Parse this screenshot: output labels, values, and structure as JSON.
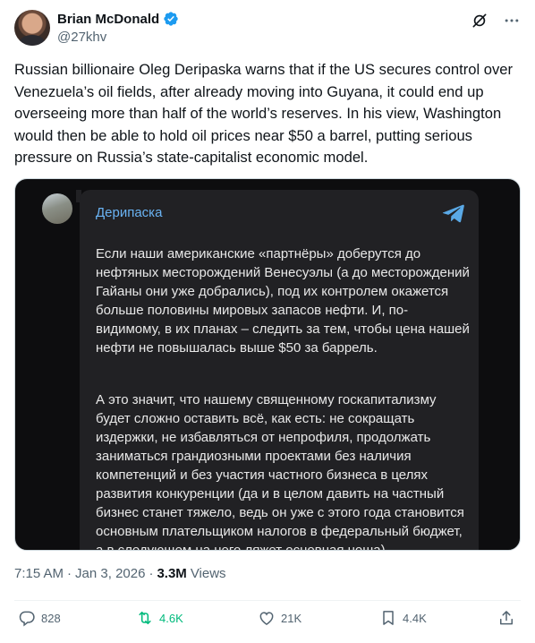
{
  "author": {
    "name": "Brian McDonald",
    "handle": "@27khv",
    "verified": true
  },
  "icons": [
    "verified-badge-icon",
    "grok-icon",
    "more-icon",
    "telegram-icon",
    "reply-icon",
    "retweet-icon",
    "like-icon",
    "bookmark-icon",
    "share-icon"
  ],
  "tweet": {
    "text": "Russian billionaire Oleg Deripaska warns that if the US secures control over Venezuela’s oil fields, after already moving into Guyana,  it could end up overseeing more than half of the world’s reserves. In his view, Washington would then be able to hold oil prices near $50 a barrel, putting serious pressure on Russia’s state-capitalist economic model."
  },
  "media": {
    "channel_name": "Дерипаска",
    "paragraph_1": "Если наши американские «партнёры» доберутся до нефтяных месторождений Венесуэлы (а до месторождений Гайаны они уже добрались), под их контролем окажется больше половины мировых запасов нефти. И, по-видимому, в их планах – следить за тем, чтобы цена нашей нефти не повышалась выше $50 за баррель.",
    "paragraph_2": "А это значит, что нашему священному госкапитализму будет сложно оставить всё, как есть: не сокращать издержки, не избавляться от непрофиля, продолжать заниматься грандиозными проектами без наличия компетенций и без участия частного бизнеса в целях развития конкуренции (да и в целом давить на частный бизнес станет тяжело, ведь он уже с этого года становится основным плательщиком налогов в федеральный бюджет, а в следующем на него ляжет основная ноша)."
  },
  "meta": {
    "time": "7:15 AM",
    "separator": "·",
    "date": "Jan 3, 2026",
    "views_count": "3.3M",
    "views_label": "Views"
  },
  "actions": {
    "replies": "828",
    "reposts": "4.6K",
    "likes": "21K",
    "bookmarks": "4.4K"
  },
  "colors": {
    "text": "#0f1419",
    "muted": "#536471",
    "verified": "#1d9bf0",
    "repost": "#00ba7c",
    "telegram_name": "#6ab3f3"
  }
}
